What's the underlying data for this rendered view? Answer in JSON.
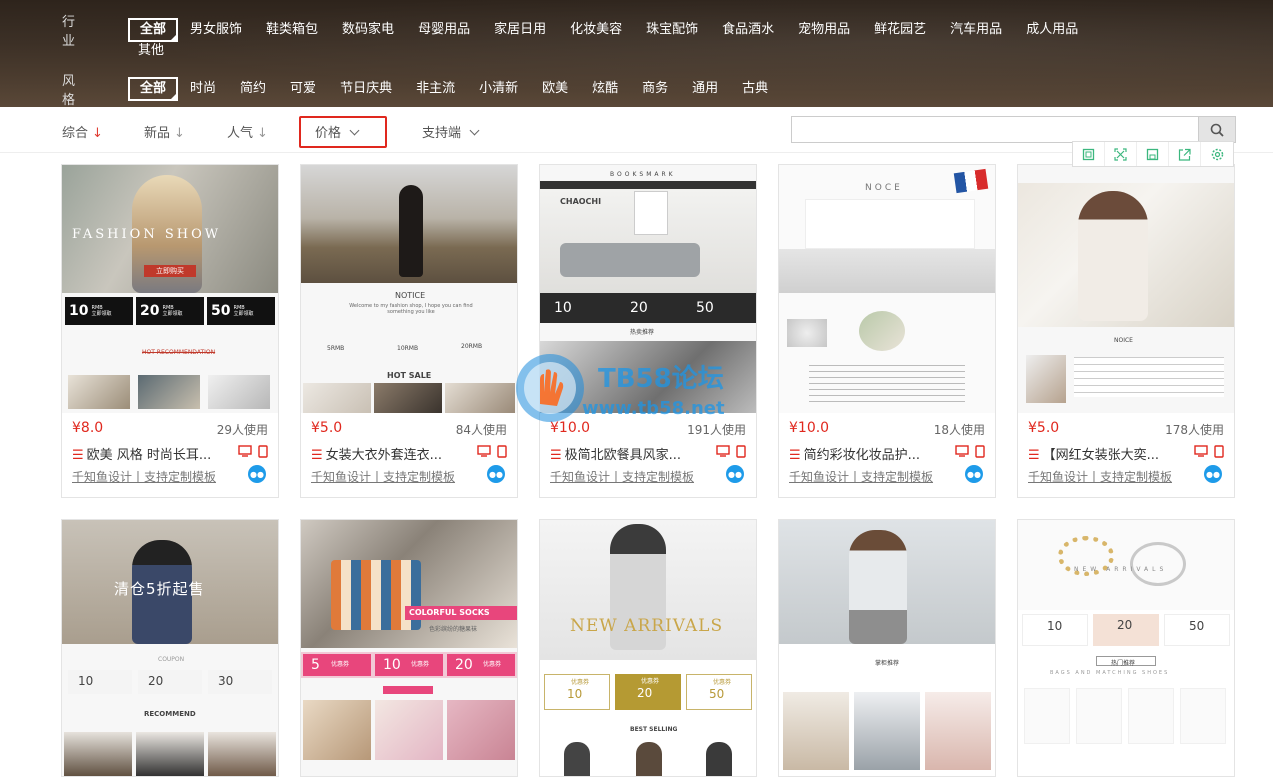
{
  "filters": {
    "industry": {
      "label": "行 业",
      "options": [
        "全部",
        "男女服饰",
        "鞋类箱包",
        "数码家电",
        "母婴用品",
        "家居日用",
        "化妆美容",
        "珠宝配饰",
        "食品酒水",
        "宠物用品",
        "鲜花园艺",
        "汽车用品",
        "成人用品"
      ],
      "wrap_option": "其他",
      "selected": "全部"
    },
    "style": {
      "label": "风 格",
      "options": [
        "全部",
        "时尚",
        "简约",
        "可爱",
        "节日庆典",
        "非主流",
        "小清新",
        "欧美",
        "炫酷",
        "商务",
        "通用",
        "古典"
      ],
      "selected": "全部"
    }
  },
  "sort": {
    "items": [
      "综合",
      "新品",
      "人气"
    ],
    "arrow": "↓",
    "price": "价格",
    "platform": "支持端"
  },
  "search": {
    "placeholder": ""
  },
  "tools": [
    "square-icon",
    "fullscreen-icon",
    "save-icon",
    "share-icon",
    "settings-icon"
  ],
  "cards": [
    {
      "price": "¥8.0",
      "usage": "29人使用",
      "title": "欧美 风格 时尚长耳...",
      "desc": "千知鱼设计丨支持定制模板",
      "thumb": {
        "banner": "FASHION SHOW",
        "cta": "立即购买",
        "coupons": [
          "10",
          "20",
          "50"
        ],
        "section": "HOT RECOMMENDATION"
      }
    },
    {
      "price": "¥5.0",
      "usage": "84人使用",
      "title": "女装大衣外套连衣...",
      "desc": "千知鱼设计丨支持定制模板",
      "thumb": {
        "notice": "NOTICE",
        "notice_text": "Welcome to my fashion shop, I hope you can find something you like",
        "rmb": [
          "5RMB",
          "10RMB",
          "20RMB"
        ],
        "hot": "HOT SALE"
      }
    },
    {
      "price": "¥10.0",
      "usage": "191人使用",
      "title": "极简北欧餐具风家...",
      "desc": "千知鱼设计丨支持定制模板",
      "thumb": {
        "brand": "BOOKSMARK",
        "logo": "CHAOCHI",
        "coupons": [
          "10",
          "20",
          "50"
        ],
        "coupon_label": "优惠券",
        "rec": "热卖推荐"
      }
    },
    {
      "price": "¥10.0",
      "usage": "18人使用",
      "title": "简约彩妆化妆品护...",
      "desc": "千知鱼设计丨支持定制模板",
      "thumb": {
        "notice": "NOCE"
      }
    },
    {
      "price": "¥5.0",
      "usage": "178人使用",
      "title": "【网红女装张大奕...",
      "desc": "千知鱼设计丨支持定制模板",
      "thumb": {
        "notice": "NOICE"
      }
    },
    {
      "thumb": {
        "banner": "清仓5折起售",
        "coupons": [
          "10",
          "20",
          "30"
        ],
        "coupon_head": "COUPON",
        "section": "RECOMMEND"
      }
    },
    {
      "thumb": {
        "banner": "COLORFUL SOCKS",
        "sub": "色彩缤纷的糖果袜",
        "coupons": [
          "5",
          "10",
          "20"
        ],
        "coupon_label": "优惠券"
      }
    },
    {
      "thumb": {
        "banner": "NEW ARRIVALS",
        "coupons": [
          "10",
          "20",
          "50"
        ],
        "coupon_label": "优惠券",
        "section": "BEST SELLING"
      }
    },
    {
      "thumb": {
        "banner": "掌柜推荐"
      }
    },
    {
      "thumb": {
        "banner": "NEW ARRIVALS",
        "coupons": [
          "10",
          "20",
          "50"
        ],
        "hot": "热门推荐",
        "sub": "BAGS AND MATCHING SHOES"
      }
    }
  ],
  "watermark": {
    "logo": "TB58论坛",
    "url": "www.tb58.net"
  },
  "colors": {
    "accent": "#e0281e",
    "link_blue": "#1e9be9"
  }
}
